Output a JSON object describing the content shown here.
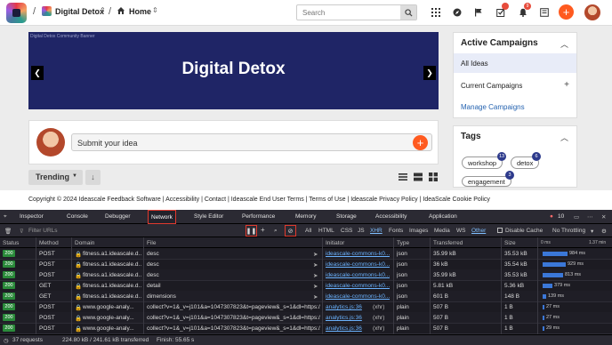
{
  "nav": {
    "separator": "/",
    "community_name": "Digital Detox",
    "home_label": "Home",
    "search_placeholder": "Search",
    "notif_count": "9"
  },
  "hero": {
    "subtitle": "Digital Detox Community Banner",
    "title": "Digital Detox"
  },
  "submit": {
    "placeholder": "Submit your idea"
  },
  "toolbar": {
    "sort_label": "Trending"
  },
  "campaigns": {
    "heading": "Active Campaigns",
    "items": [
      "All Ideas",
      "Current Campaigns",
      "Manage Campaigns"
    ]
  },
  "tags": {
    "heading": "Tags",
    "items": [
      {
        "label": "workshop",
        "count": "13"
      },
      {
        "label": "detox",
        "count": "6"
      },
      {
        "label": "engagement",
        "count": "3"
      }
    ]
  },
  "footer": {
    "text": "Copyright © 2024 Ideascale Feedback Software | Accessibility | Contact | Ideascale End User Terms | Terms of Use | Ideascale Privacy Policy | IdeaScale Cookie Policy"
  },
  "devtools": {
    "tabs": [
      "Inspector",
      "Console",
      "Debugger",
      "Network",
      "Style Editor",
      "Performance",
      "Memory",
      "Storage",
      "Accessibility",
      "Application"
    ],
    "selected_tab": "Network",
    "error_count": "10",
    "filter_placeholder": "Filter URLs",
    "filters": [
      "All",
      "HTML",
      "CSS",
      "JS",
      "XHR",
      "Fonts",
      "Images",
      "Media",
      "WS",
      "Other"
    ],
    "active_filter": "XHR",
    "disable_cache": "Disable Cache",
    "throttling": "No Throttling",
    "columns": [
      "Status",
      "Method",
      "Domain",
      "File",
      "Initiator",
      "Type",
      "Transferred",
      "Size"
    ],
    "timeline_ticks": [
      "0 ms",
      "1.37 min"
    ],
    "rows": [
      {
        "status": "200",
        "method": "POST",
        "domain": "fitness.a1.ideascale.d...",
        "file": "desc",
        "initiator": "ideascale-commons-k0...",
        "type": "json",
        "transferred": "35.99 kB",
        "size": "35.53 kB",
        "time": "984 ms"
      },
      {
        "status": "200",
        "method": "POST",
        "domain": "fitness.a1.ideascale.d...",
        "file": "desc",
        "initiator": "ideascale-commons-k0...",
        "type": "json",
        "transferred": "36 kB",
        "size": "35.54 kB",
        "time": "929 ms"
      },
      {
        "status": "200",
        "method": "POST",
        "domain": "fitness.a1.ideascale.d...",
        "file": "desc",
        "initiator": "ideascale-commons-k0...",
        "type": "json",
        "transferred": "35.99 kB",
        "size": "35.53 kB",
        "time": "813 ms"
      },
      {
        "status": "200",
        "method": "GET",
        "domain": "fitness.a1.ideascale.d...",
        "file": "detail",
        "initiator": "ideascale-commons-k0...",
        "type": "json",
        "transferred": "5.81 kB",
        "size": "5.36 kB",
        "time": "379 ms"
      },
      {
        "status": "200",
        "method": "GET",
        "domain": "fitness.a1.ideascale.d...",
        "file": "dimensions",
        "initiator": "ideascale-commons-k0...",
        "type": "json",
        "transferred": "601 B",
        "size": "148 B",
        "time": "139 ms"
      },
      {
        "status": "200",
        "method": "POST",
        "domain": "www.google-analy...",
        "file": "collect?v=1&_v=j101&a=1047307823&t=pageview&_s=1&dl=https://f",
        "initiator": "analytics.js:36",
        "type": "plain",
        "transferred": "507 B",
        "size": "1 B",
        "time": "27 ms"
      },
      {
        "status": "200",
        "method": "POST",
        "domain": "www.google-analy...",
        "file": "collect?v=1&_v=j101&a=1047307823&t=pageview&_s=1&dl=https://f",
        "initiator": "analytics.js:36",
        "type": "plain",
        "transferred": "507 B",
        "size": "1 B",
        "time": "27 ms"
      },
      {
        "status": "200",
        "method": "POST",
        "domain": "www.google-analy...",
        "file": "collect?v=1&_v=j101&a=1047307823&t=pageview&_s=1&dl=https://f",
        "initiator": "analytics.js:36",
        "type": "plain",
        "transferred": "507 B",
        "size": "1 B",
        "time": "29 ms"
      }
    ],
    "initiator_suffix": "(xhr)",
    "status_bar": {
      "requests": "37 requests",
      "transferred": "224.80 kB / 241.61 kB transferred",
      "finish": "Finish: 55.65 s"
    }
  }
}
